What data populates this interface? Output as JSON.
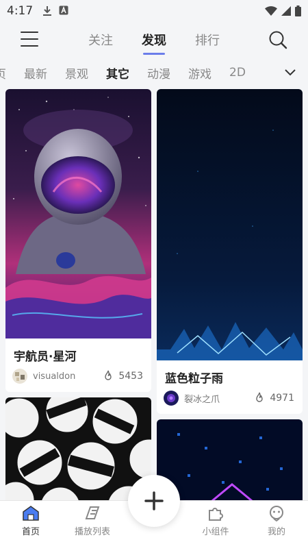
{
  "status_bar": {
    "time": "4:17"
  },
  "top_nav": {
    "tabs": [
      {
        "label": "关注"
      },
      {
        "label": "发现"
      },
      {
        "label": "排行"
      }
    ],
    "active_tab": "发现"
  },
  "categories": {
    "items": [
      {
        "label": "页"
      },
      {
        "label": "最新"
      },
      {
        "label": "景观"
      },
      {
        "label": "其它"
      },
      {
        "label": "动漫"
      },
      {
        "label": "游戏"
      },
      {
        "label": "2D"
      }
    ],
    "active": "其它"
  },
  "cards": [
    {
      "title": "宇航员·星河",
      "author": "visualdon",
      "likes": "5453"
    },
    {
      "title": "蓝色粒子雨",
      "author": "裂冰之爪",
      "likes": "4971"
    }
  ],
  "bottom_nav": {
    "items": [
      {
        "label": "首页"
      },
      {
        "label": "播放列表"
      },
      {
        "label": "小组件"
      },
      {
        "label": "我的"
      }
    ]
  },
  "colors": {
    "accent": "#6b7dea",
    "home_icon": "#4a7cf0"
  }
}
